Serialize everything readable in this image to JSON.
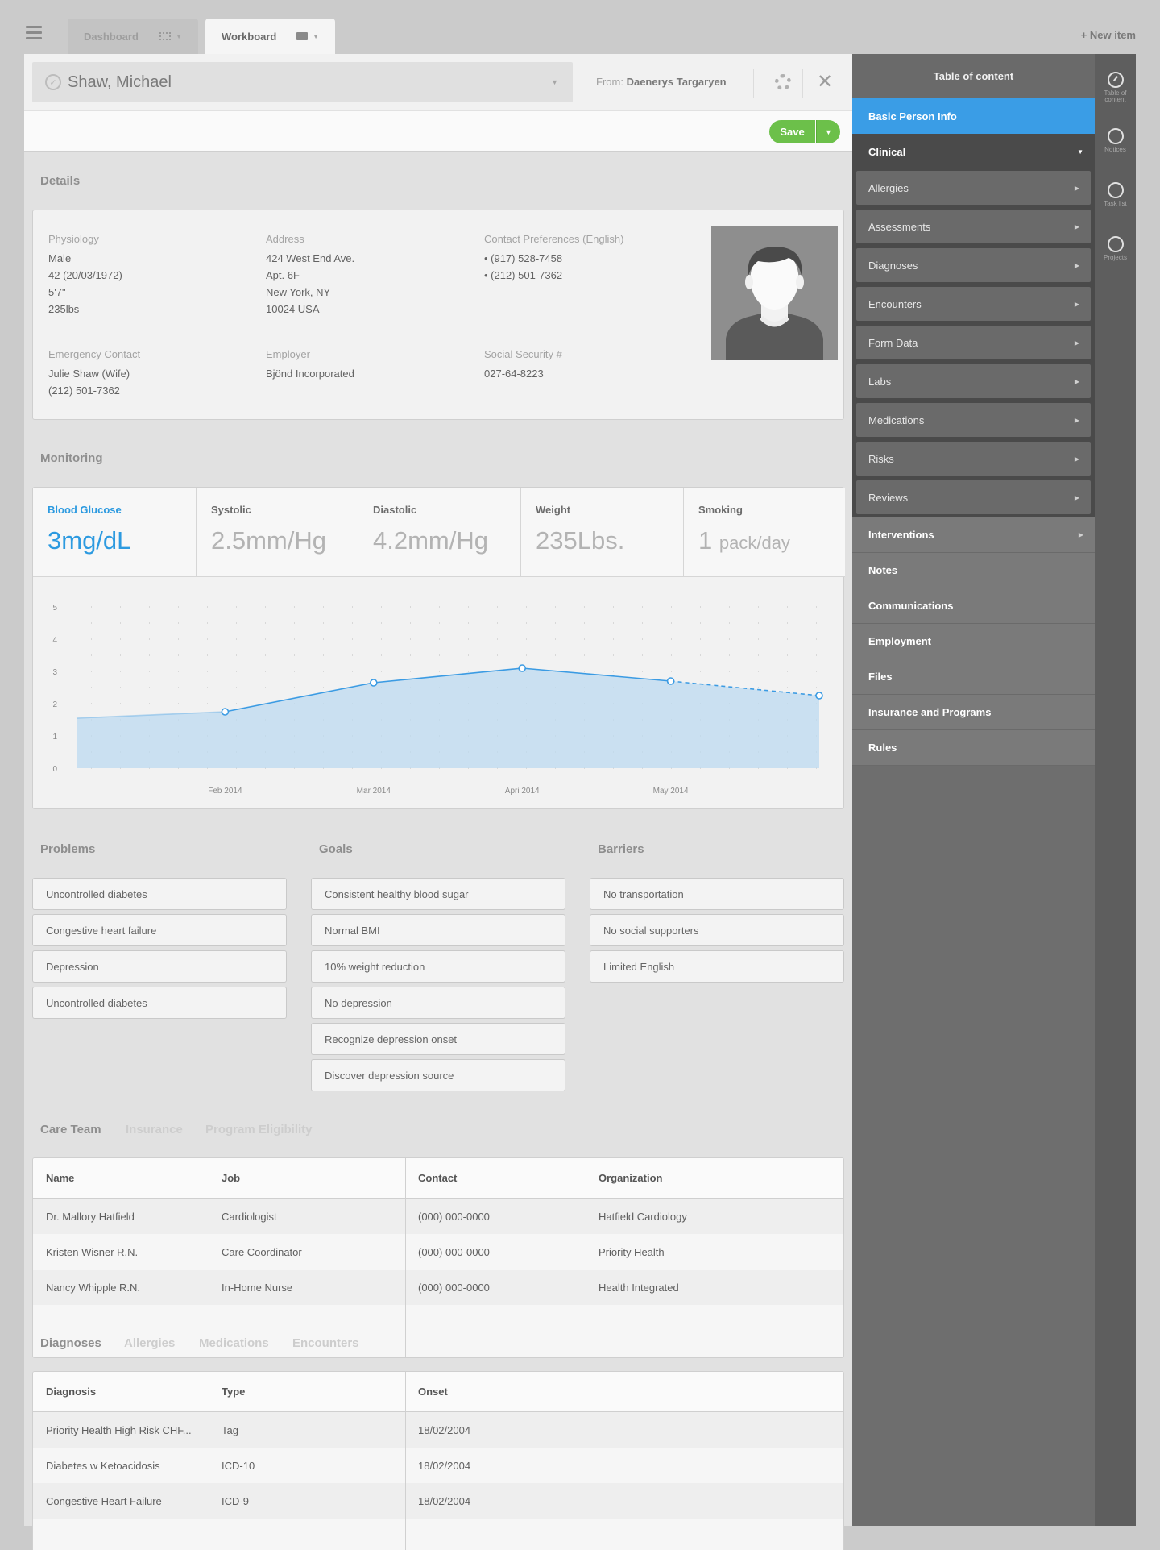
{
  "topbar": {
    "tabs": [
      {
        "label": "Dashboard"
      },
      {
        "label": "Workboard"
      }
    ],
    "new_item": "+ New item"
  },
  "header": {
    "patient_name": "Shaw, Michael",
    "from_label": "From:",
    "from_name": "Daenerys Targaryen",
    "save_label": "Save"
  },
  "details": {
    "title": "Details",
    "physiology": {
      "label": "Physiology",
      "lines": [
        "Male",
        "42 (20/03/1972)",
        "5'7\"",
        "235lbs"
      ]
    },
    "address": {
      "label": "Address",
      "lines": [
        "424 West End Ave.",
        "Apt. 6F",
        "New York, NY",
        "10024 USA"
      ]
    },
    "contact": {
      "label": "Contact Preferences (English)",
      "lines": [
        "• (917) 528-7458",
        "• (212) 501-7362"
      ]
    },
    "emergency": {
      "label": "Emergency Contact",
      "lines": [
        "Julie Shaw (Wife)",
        "(212) 501-7362"
      ]
    },
    "employer": {
      "label": "Employer",
      "lines": [
        "Bjönd Incorporated"
      ]
    },
    "ssn": {
      "label": "Social Security #",
      "lines": [
        "027-64-8223"
      ]
    }
  },
  "monitoring": {
    "title": "Monitoring",
    "metrics": [
      {
        "label": "Blood Glucose",
        "value": "3mg/dL",
        "unit": ""
      },
      {
        "label": "Systolic",
        "value": "2.5mm/Hg",
        "unit": ""
      },
      {
        "label": "Diastolic",
        "value": "4.2mm/Hg",
        "unit": ""
      },
      {
        "label": "Weight",
        "value": "235Lbs.",
        "unit": ""
      },
      {
        "label": "Smoking",
        "value": "1",
        "unit": "pack/day"
      }
    ]
  },
  "chart_data": {
    "type": "area",
    "title": "",
    "xlabel": "",
    "ylabel": "",
    "ylim": [
      0,
      5
    ],
    "yticks": [
      "0",
      "1",
      "2",
      "3",
      "4",
      "5"
    ],
    "xtick_labels": [
      "Feb 2014",
      "Mar 2014",
      "Apri 2014",
      "May 2014"
    ],
    "x": [
      "Jan 2014",
      "Feb 2014",
      "Mar 2014",
      "Apri 2014",
      "May 2014",
      "Jun 2014"
    ],
    "values": [
      1.55,
      1.75,
      2.65,
      3.1,
      2.7,
      2.25
    ],
    "markers_on": [
      "Feb 2014",
      "Mar 2014",
      "Apri 2014",
      "May 2014",
      "Jun 2014"
    ],
    "projected_from": "May 2014",
    "grid": true,
    "colors": {
      "line": "#3b9be3",
      "fill": "#bcd9f0"
    }
  },
  "problems": {
    "title": "Problems",
    "items": [
      "Uncontrolled diabetes",
      "Congestive heart failure",
      "Depression",
      "Uncontrolled diabetes"
    ]
  },
  "goals": {
    "title": "Goals",
    "items": [
      "Consistent healthy blood sugar",
      "Normal BMI",
      "10% weight reduction",
      "No depression",
      "Recognize depression onset",
      "Discover depression source"
    ]
  },
  "barriers": {
    "title": "Barriers",
    "items": [
      "No transportation",
      "No social supporters",
      "Limited English"
    ]
  },
  "care_team": {
    "tabs": [
      "Care Team",
      "Insurance",
      "Program Eligibility"
    ],
    "columns": [
      "Name",
      "Job",
      "Contact",
      "Organization"
    ],
    "rows": [
      [
        "Dr. Mallory Hatfield",
        "Cardiologist",
        "(000) 000-0000",
        "Hatfield Cardiology"
      ],
      [
        "Kristen Wisner  R.N.",
        "Care Coordinator",
        "(000) 000-0000",
        "Priority Health"
      ],
      [
        "Nancy Whipple R.N.",
        "In-Home Nurse",
        "(000) 000-0000",
        "Health Integrated"
      ]
    ]
  },
  "diagnoses": {
    "tabs": [
      "Diagnoses",
      "Allergies",
      "Medications",
      "Encounters"
    ],
    "columns": [
      "Diagnosis",
      "Type",
      "Onset"
    ],
    "rows": [
      [
        "Priority Health High Risk CHF...",
        "Tag",
        "18/02/2004"
      ],
      [
        "Diabetes w Ketoacidosis",
        "ICD-10",
        "18/02/2004"
      ],
      [
        "Congestive Heart Failure",
        "ICD-9",
        "18/02/2004"
      ]
    ]
  },
  "toc": {
    "title": "Table of content",
    "basic": "Basic Person Info",
    "clinical": "Clinical",
    "clinical_items": [
      "Allergies",
      "Assessments",
      "Diagnoses",
      "Encounters",
      "Form Data",
      "Labs",
      "Medications",
      "Risks",
      "Reviews"
    ],
    "items": [
      "Interventions",
      "Notes",
      "Communications",
      "Employment",
      "Files",
      "Insurance and Programs",
      "Rules"
    ]
  },
  "rail": [
    {
      "label1": "Table of",
      "label2": "content"
    },
    {
      "label1": "Notices",
      "label2": ""
    },
    {
      "label1": "Task list",
      "label2": ""
    },
    {
      "label1": "Projects",
      "label2": ""
    }
  ]
}
